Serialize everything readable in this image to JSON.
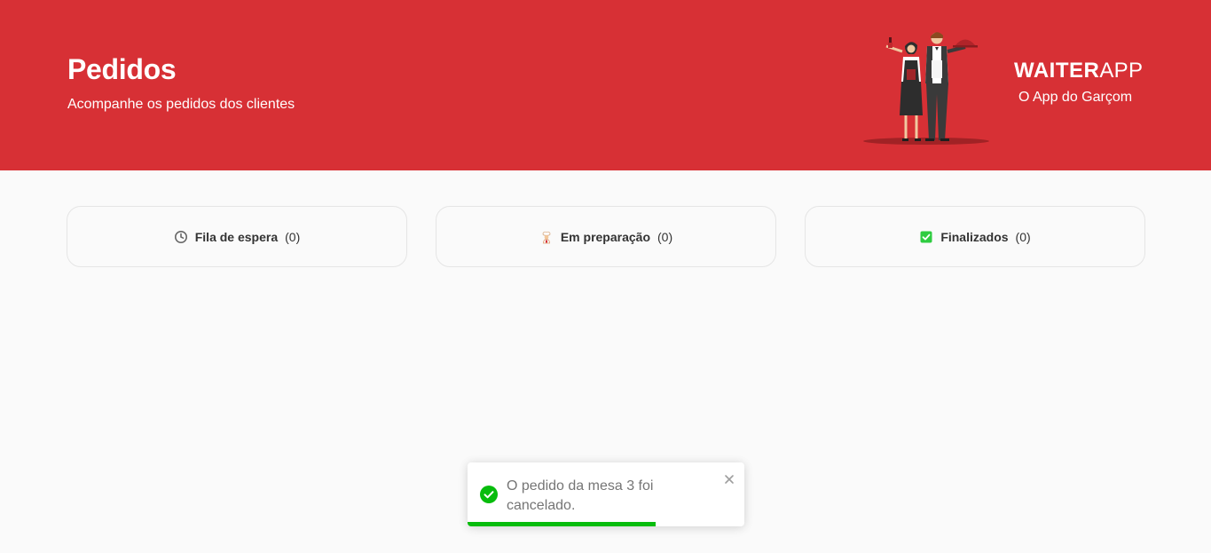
{
  "header": {
    "title": "Pedidos",
    "subtitle": "Acompanhe os pedidos dos clientes",
    "logo_bold": "WAITER",
    "logo_light": "APP",
    "logo_tagline": "O App do Garçom",
    "background_color": "#d73035"
  },
  "boards": [
    {
      "icon": "clock-icon",
      "label": "Fila de espera",
      "count": "(0)"
    },
    {
      "icon": "cook-icon",
      "label": "Em preparação",
      "count": "(0)"
    },
    {
      "icon": "checkbox-checked-icon",
      "label": "Finalizados",
      "count": "(0)"
    }
  ],
  "toast": {
    "icon": "check-circle-icon",
    "message": "O pedido da mesa 3 foi cancelado.",
    "progress": 0.68,
    "accent_color": "#07bc0c"
  }
}
